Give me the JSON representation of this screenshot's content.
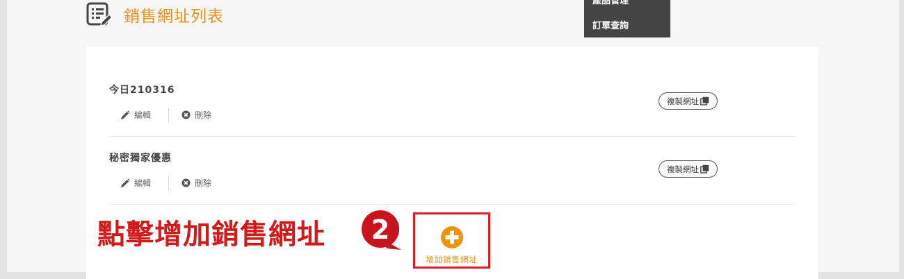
{
  "header": {
    "title": "銷售網址列表",
    "icon": "list-edit-icon"
  },
  "dropdown": {
    "items": [
      {
        "label": "產品管理"
      },
      {
        "label": "訂單查詢"
      }
    ]
  },
  "urls": [
    {
      "name": "今日210316",
      "edit_label": "編輯",
      "delete_label": "刪除",
      "copy_label": "複製網址"
    },
    {
      "name": "秘密獨家優惠",
      "edit_label": "編輯",
      "delete_label": "刪除",
      "copy_label": "複製網址"
    }
  ],
  "annotation": {
    "text": "點擊增加銷售網址",
    "step": "2"
  },
  "add_button": {
    "label": "增加銷售網址"
  },
  "colors": {
    "accent": "#e7921d",
    "annotation": "#d11b1b",
    "dropdown_bg": "#444444"
  }
}
